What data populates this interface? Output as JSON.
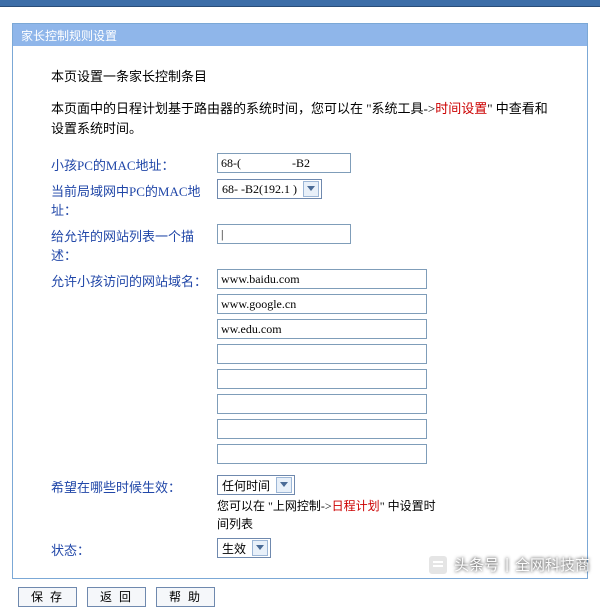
{
  "header": {
    "title": "家长控制规则设置"
  },
  "intro": {
    "line1": "本页设置一条家长控制条目",
    "line2a": "本页面中的日程计划基于路由器的系统时间，您可以在 \"系统工具->",
    "line2b_red": "时间设置",
    "line2c": "\" 中查看和设置系统时间。"
  },
  "labels": {
    "child_mac": "小孩PC的MAC地址：",
    "lan_mac": "当前局域网中PC的MAC地址：",
    "allow_desc": "给允许的网站列表一个描述：",
    "allow_sites": "允许小孩访问的网站域名：",
    "time": "希望在哪些时候生效：",
    "status": "状态："
  },
  "values": {
    "child_mac": "68-(                 -B2",
    "lan_mac_text": "68-             -B2(192.1            )",
    "allow_desc": "|",
    "sites": [
      "www.baidu.com",
      "www.google.cn",
      "ww.edu.com",
      "",
      "",
      "",
      "",
      ""
    ],
    "time_selected": "任何时间",
    "status_selected": "生效"
  },
  "notes": {
    "time_a": "您可以在 \"上网控制->",
    "time_b_red": "日程计划",
    "time_c": "\" 中设置时间列表"
  },
  "buttons": {
    "save": "保 存",
    "back": "返 回",
    "help": "帮 助"
  },
  "watermark": {
    "src": "头条号",
    "name": "全网科技商"
  }
}
